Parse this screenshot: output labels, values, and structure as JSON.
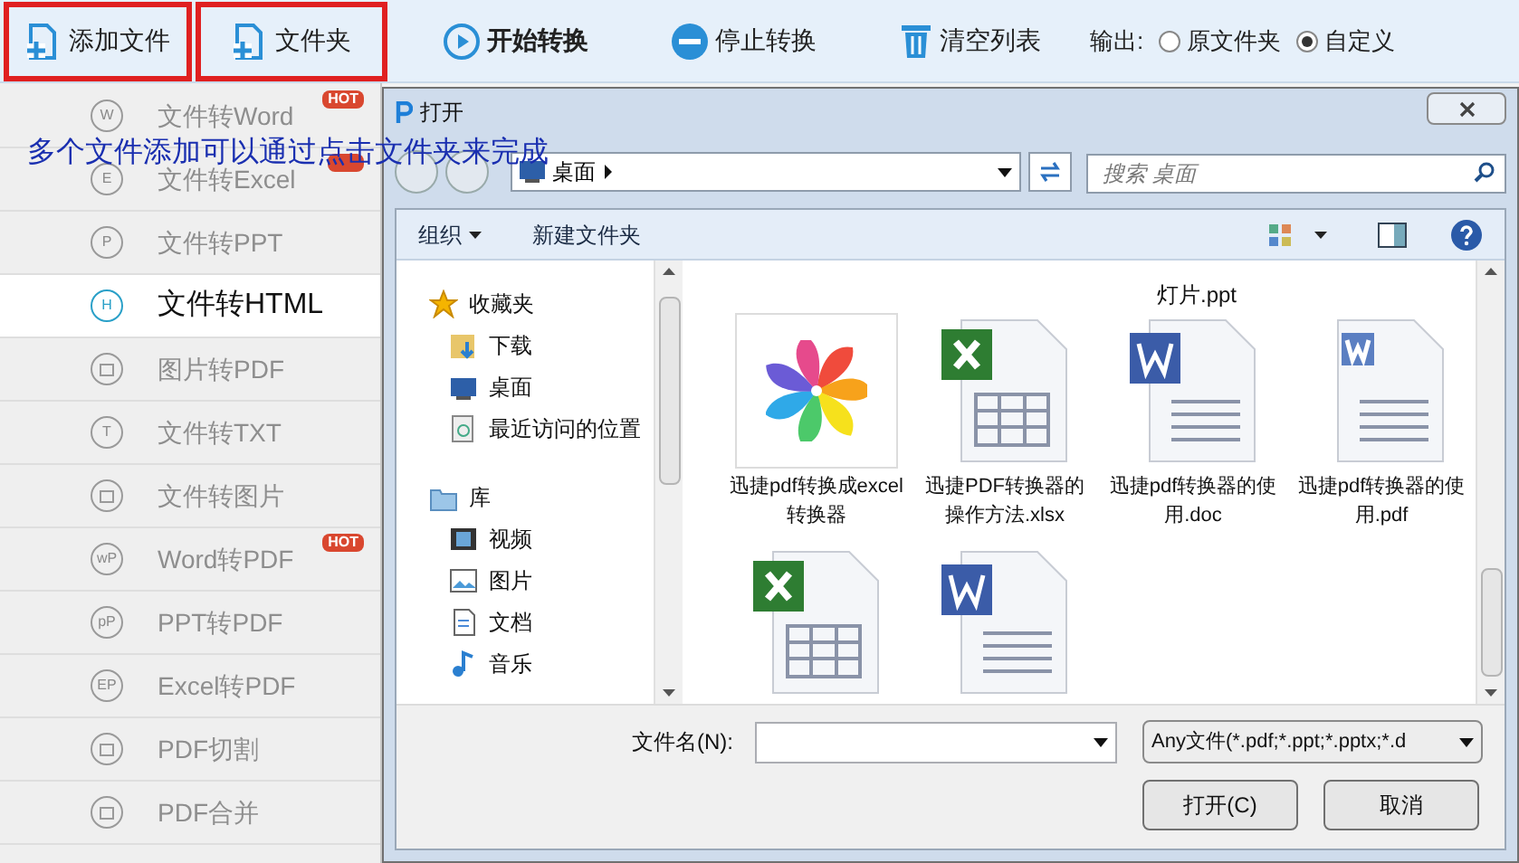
{
  "toolbar": {
    "buttons": [
      {
        "label": "添加文件",
        "kind": "add-file",
        "highlighted": true
      },
      {
        "label": "文件夹",
        "kind": "add-folder",
        "highlighted": true
      },
      {
        "label": "开始转换",
        "kind": "start",
        "highlighted": false
      },
      {
        "label": "停止转换",
        "kind": "stop",
        "highlighted": false
      },
      {
        "label": "清空列表",
        "kind": "clear",
        "highlighted": false
      }
    ],
    "output": {
      "label": "输出:",
      "options": [
        {
          "label": "原文件夹",
          "selected": false
        },
        {
          "label": "自定义",
          "selected": true
        }
      ]
    }
  },
  "sidebar": {
    "items": [
      {
        "label": "文件转Word",
        "icon": "W",
        "hot": true,
        "badge": "HOT",
        "selected": false
      },
      {
        "label": "文件转Excel",
        "icon": "E",
        "hot": true,
        "selected": false
      },
      {
        "label": "文件转PPT",
        "icon": "P",
        "hot": false,
        "selected": false
      },
      {
        "label": "文件转HTML",
        "icon": "H",
        "hot": false,
        "selected": true
      },
      {
        "label": "图片转PDF",
        "hot": false,
        "selected": false
      },
      {
        "label": "文件转TXT",
        "icon": "T",
        "hot": false,
        "selected": false
      },
      {
        "label": "文件转图片",
        "hot": false,
        "selected": false
      },
      {
        "label": "Word转PDF",
        "icon": "wP",
        "hot": true,
        "badge": "HOT",
        "selected": false
      },
      {
        "label": "PPT转PDF",
        "icon": "pP",
        "hot": false,
        "selected": false
      },
      {
        "label": "Excel转PDF",
        "icon": "EP",
        "hot": false,
        "selected": false
      },
      {
        "label": "PDF切割",
        "hot": false,
        "selected": false
      },
      {
        "label": "PDF合并",
        "hot": false,
        "selected": false
      }
    ]
  },
  "annotation": "多个文件添加可以通过点击文件夹来完成",
  "dialog": {
    "title": "打开",
    "address": "桌面",
    "search": {
      "placeholder": "搜索 桌面"
    },
    "commands": [
      "组织",
      "新建文件夹"
    ],
    "nav": [
      {
        "label": "收藏夹",
        "kind": "star",
        "children": [
          {
            "label": "下载",
            "kind": "download"
          },
          {
            "label": "桌面",
            "kind": "desktop"
          },
          {
            "label": "最近访问的位置",
            "kind": "recent"
          }
        ]
      },
      {
        "label": "库",
        "kind": "library",
        "children": [
          {
            "label": "视频",
            "kind": "video"
          },
          {
            "label": "图片",
            "kind": "picture"
          },
          {
            "label": "文档",
            "kind": "document"
          },
          {
            "label": "音乐",
            "kind": "music"
          }
        ]
      }
    ],
    "partial_labels": [
      "灯片.ppt"
    ],
    "files": [
      {
        "name": "迅捷pdf转换成excel转换器",
        "kind": "app"
      },
      {
        "name": "迅捷PDF转换器的操作方法.xlsx",
        "kind": "xlsx"
      },
      {
        "name": "迅捷pdf转换器的使用.doc",
        "kind": "doc"
      },
      {
        "name": "迅捷pdf转换器的使用.pdf",
        "kind": "wps"
      },
      {
        "kind": "xlsx"
      },
      {
        "kind": "doc"
      }
    ],
    "filename": {
      "label": "文件名(N):"
    },
    "filter": "Any文件(*.pdf;*.ppt;*.pptx;*.d",
    "buttons": [
      "打开(C)",
      "取消"
    ]
  }
}
